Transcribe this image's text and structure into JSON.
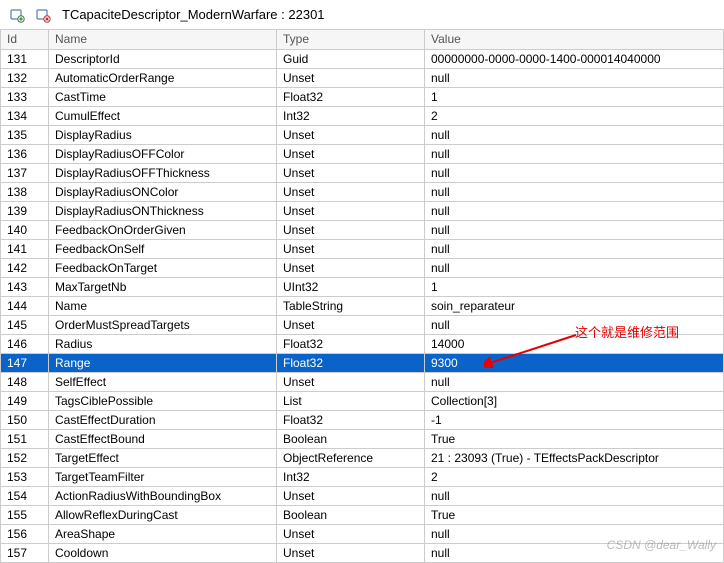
{
  "title": "TCapaciteDescriptor_ModernWarfare : 22301",
  "columns": {
    "id": "Id",
    "name": "Name",
    "type": "Type",
    "value": "Value"
  },
  "selected_id": "147",
  "rows": [
    {
      "id": "131",
      "name": "DescriptorId",
      "type": "Guid",
      "value": "00000000-0000-0000-1400-000014040000"
    },
    {
      "id": "132",
      "name": "AutomaticOrderRange",
      "type": "Unset",
      "value": "null"
    },
    {
      "id": "133",
      "name": "CastTime",
      "type": "Float32",
      "value": "1"
    },
    {
      "id": "134",
      "name": "CumulEffect",
      "type": "Int32",
      "value": "2"
    },
    {
      "id": "135",
      "name": "DisplayRadius",
      "type": "Unset",
      "value": "null"
    },
    {
      "id": "136",
      "name": "DisplayRadiusOFFColor",
      "type": "Unset",
      "value": "null"
    },
    {
      "id": "137",
      "name": "DisplayRadiusOFFThickness",
      "type": "Unset",
      "value": "null"
    },
    {
      "id": "138",
      "name": "DisplayRadiusONColor",
      "type": "Unset",
      "value": "null"
    },
    {
      "id": "139",
      "name": "DisplayRadiusONThickness",
      "type": "Unset",
      "value": "null"
    },
    {
      "id": "140",
      "name": "FeedbackOnOrderGiven",
      "type": "Unset",
      "value": "null"
    },
    {
      "id": "141",
      "name": "FeedbackOnSelf",
      "type": "Unset",
      "value": "null"
    },
    {
      "id": "142",
      "name": "FeedbackOnTarget",
      "type": "Unset",
      "value": "null"
    },
    {
      "id": "143",
      "name": "MaxTargetNb",
      "type": "UInt32",
      "value": "1"
    },
    {
      "id": "144",
      "name": "Name",
      "type": "TableString",
      "value": "soin_reparateur"
    },
    {
      "id": "145",
      "name": "OrderMustSpreadTargets",
      "type": "Unset",
      "value": "null"
    },
    {
      "id": "146",
      "name": "Radius",
      "type": "Float32",
      "value": "14000"
    },
    {
      "id": "147",
      "name": "Range",
      "type": "Float32",
      "value": "9300"
    },
    {
      "id": "148",
      "name": "SelfEffect",
      "type": "Unset",
      "value": "null"
    },
    {
      "id": "149",
      "name": "TagsCiblePossible",
      "type": "List",
      "value": "Collection[3]"
    },
    {
      "id": "150",
      "name": "CastEffectDuration",
      "type": "Float32",
      "value": "-1"
    },
    {
      "id": "151",
      "name": "CastEffectBound",
      "type": "Boolean",
      "value": "True"
    },
    {
      "id": "152",
      "name": "TargetEffect",
      "type": "ObjectReference",
      "value": "21 : 23093 (True) - TEffectsPackDescriptor"
    },
    {
      "id": "153",
      "name": "TargetTeamFilter",
      "type": "Int32",
      "value": "2"
    },
    {
      "id": "154",
      "name": "ActionRadiusWithBoundingBox",
      "type": "Unset",
      "value": "null"
    },
    {
      "id": "155",
      "name": "AllowReflexDuringCast",
      "type": "Boolean",
      "value": "True"
    },
    {
      "id": "156",
      "name": "AreaShape",
      "type": "Unset",
      "value": "null"
    },
    {
      "id": "157",
      "name": "Cooldown",
      "type": "Unset",
      "value": "null"
    }
  ],
  "annotation": "这个就是维修范围",
  "watermark": "CSDN @dear_Wally"
}
